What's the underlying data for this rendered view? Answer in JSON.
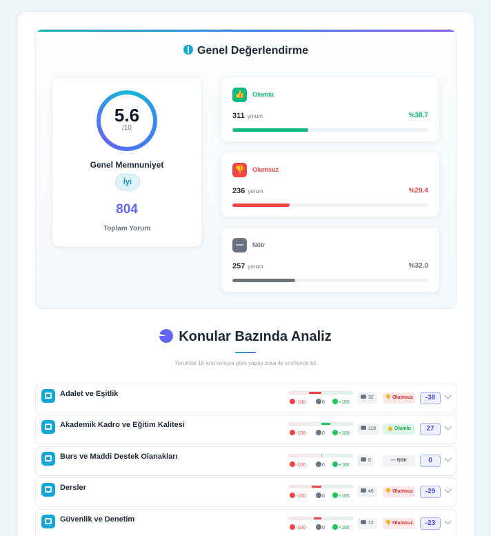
{
  "overall": {
    "title": "Genel Değerlendirme",
    "score": "5.6",
    "score_max": "/10",
    "score_label": "Genel Memnuniyet",
    "rating_badge": "İyi",
    "total": "804",
    "total_label": "Toplam Yorum"
  },
  "sentiments": [
    {
      "name": "Olumlu",
      "count": "311",
      "unit": "yorum",
      "pct": "%38.7",
      "fill": 0.387,
      "color": "#10b981",
      "icon": "thumbs-up-icon"
    },
    {
      "name": "Olumsuz",
      "count": "236",
      "unit": "yorum",
      "pct": "%29.4",
      "fill": 0.294,
      "color": "#ef4444",
      "icon": "thumbs-down-icon"
    },
    {
      "name": "Nötr",
      "count": "257",
      "unit": "yorum",
      "pct": "%32.0",
      "fill": 0.32,
      "color": "#6b7280",
      "icon": "minus-icon"
    }
  ],
  "topics_section": {
    "title": "Konular Bazında Analiz",
    "subtitle": "Yorumlar 18 ana konuya göre yapay zeka ile sınıflandırıldı"
  },
  "scale_labels": {
    "neg": "-100",
    "zero": "0",
    "pos": "+100"
  },
  "topics": [
    {
      "name": "Adalet ve Eşitlik",
      "count": "32",
      "sentiment": "Olumsuz",
      "score": "-38",
      "value": -38,
      "icon": "scales-icon"
    },
    {
      "name": "Akademik Kadro ve Eğitim Kalitesi",
      "count": "116",
      "sentiment": "Olumlu",
      "score": "27",
      "value": 27,
      "icon": "teacher-icon"
    },
    {
      "name": "Burs ve Maddi Destek Olanakları",
      "count": "0",
      "sentiment": "Nötr",
      "score": "0",
      "value": 0,
      "icon": "money-hand-icon"
    },
    {
      "name": "Dersler",
      "count": "46",
      "sentiment": "Olumsuz",
      "score": "-29",
      "value": -29,
      "icon": "book-icon"
    },
    {
      "name": "Güvenlik ve Denetim",
      "count": "12",
      "sentiment": "Olumsuz",
      "score": "-23",
      "value": -23,
      "icon": "shield-icon"
    }
  ],
  "sentiment_icons": {
    "Olumlu": "👍",
    "Olumsuz": "👎",
    "Nötr": "—"
  }
}
